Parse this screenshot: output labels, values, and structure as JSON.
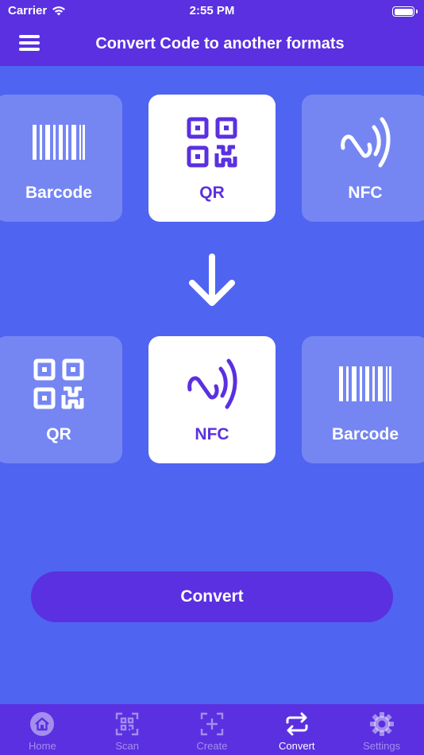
{
  "status_bar": {
    "carrier": "Carrier",
    "time": "2:55 PM"
  },
  "header": {
    "title": "Convert Code to another formats"
  },
  "source_row": [
    {
      "label": "Barcode",
      "icon": "barcode-icon"
    },
    {
      "label": "QR",
      "icon": "qr-code-icon",
      "selected": true
    },
    {
      "label": "NFC",
      "icon": "nfc-icon"
    }
  ],
  "target_row": [
    {
      "label": "QR",
      "icon": "qr-code-icon"
    },
    {
      "label": "NFC",
      "icon": "nfc-icon",
      "selected": true
    },
    {
      "label": "Barcode",
      "icon": "barcode-icon"
    }
  ],
  "convert_button": {
    "label": "Convert"
  },
  "tabbar": [
    {
      "label": "Home",
      "icon": "home-icon"
    },
    {
      "label": "Scan",
      "icon": "scan-icon"
    },
    {
      "label": "Create",
      "icon": "create-icon"
    },
    {
      "label": "Convert",
      "icon": "convert-icon",
      "active": true
    },
    {
      "label": "Settings",
      "icon": "gear-icon"
    }
  ],
  "colors": {
    "background": "#4f64f0",
    "header": "#5a30e0",
    "accent": "#5a30e0",
    "card": "#ffffff",
    "card_translucent": "rgba(255,255,255,0.22)"
  }
}
